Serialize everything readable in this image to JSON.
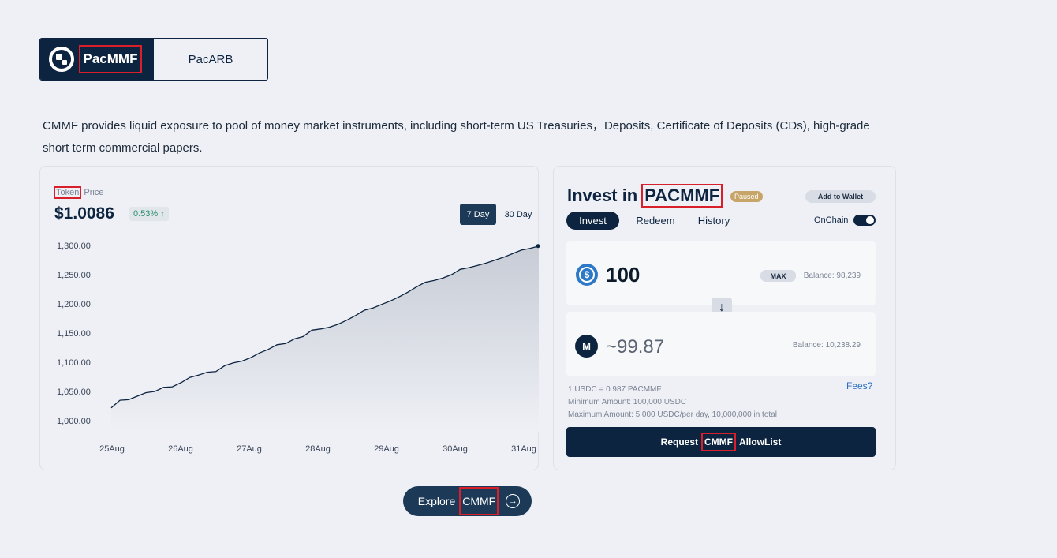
{
  "tabs": [
    {
      "label": "PacMMF",
      "active": true
    },
    {
      "label": "PacARB",
      "active": false
    }
  ],
  "description": "CMMF provides liquid exposure to pool of money market instruments, including short-term US Treasuries，Deposits, Certificate of Deposits (CDs), high-grade short term commercial papers.",
  "price_panel": {
    "label_token": "Token",
    "label_price": "Price",
    "value": "$1.0086",
    "change": "0.53% ↑",
    "ranges": [
      "7 Day",
      "30 Day"
    ]
  },
  "chart_data": {
    "type": "area",
    "x": [
      "25Aug",
      "26Aug",
      "27Aug",
      "28Aug",
      "29Aug",
      "30Aug",
      "31Aug"
    ],
    "y_ticks": [
      "1,300.00",
      "1,250.00",
      "1,200.00",
      "1,150.00",
      "1,100.00",
      "1,050.00",
      "1,000.00"
    ],
    "ylim": [
      1000,
      1300
    ],
    "series": [
      {
        "values": [
          1022,
          1035,
          1036,
          1042,
          1048,
          1050,
          1057,
          1058,
          1065,
          1074,
          1078,
          1083,
          1084,
          1094,
          1099,
          1102,
          1108,
          1116,
          1122,
          1130,
          1132,
          1140,
          1144,
          1155,
          1157,
          1160,
          1165,
          1172,
          1180,
          1189,
          1193,
          1199,
          1205,
          1212,
          1220,
          1229,
          1237,
          1240,
          1244,
          1250,
          1259,
          1262,
          1266,
          1270,
          1275,
          1280,
          1286,
          1292,
          1295,
          1299
        ]
      }
    ],
    "grid": false
  },
  "invest": {
    "title_prefix": "Invest in",
    "title_token": "PACMMF",
    "paused": "Paused",
    "add_wallet": "Add to Wallet",
    "subtabs": [
      "Invest",
      "Redeem",
      "History"
    ],
    "onchain": "OnChain",
    "amount_in": "100",
    "max": "MAX",
    "balance_in": "Balance: 98,239",
    "amount_out": "~99.87",
    "balance_out": "Balance: 10,238.29",
    "rate": "1 USDC = 0.987 PACMMF",
    "min_amount": "Minimum Amount: 100,000 USDC",
    "max_amount": "Maximum Amount: 5,000 USDC/per day, 10,000,000 in total",
    "fees": "Fees?",
    "request_prefix": "Request",
    "request_token": "CMMF",
    "request_suffix": "AllowList"
  },
  "explore": {
    "prefix": "Explore",
    "token": "CMMF"
  },
  "colors": {
    "navy": "#0d2440",
    "background": "#eef0f5",
    "positive": "#2e8c6d",
    "paused": "#c7a568",
    "link": "#2b6fc4"
  }
}
